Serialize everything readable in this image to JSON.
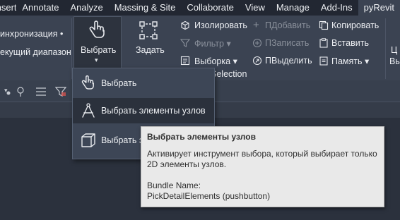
{
  "tabs": [
    "Insert",
    "Annotate",
    "Analyze",
    "Massing & Site",
    "Collaborate",
    "View",
    "Manage",
    "Add-Ins",
    "pyRevit"
  ],
  "active_tab": "pyRevit",
  "ribbon": {
    "left_item_1": "инхронизация",
    "left_item_1_suffix": "•",
    "left_item_2": "екущий диапазон",
    "select_button": "Выбрать",
    "select_arrow": "▾",
    "set_button": "Задать",
    "isolate": "Изолировать",
    "filter": "Фильтр",
    "selection": "Выборка",
    "p_add": "ПДобавить",
    "p_record": "ПЗаписать",
    "p_highlight": "ПВыделить",
    "copy": "Копировать",
    "paste": "Вставить",
    "memory": "Память",
    "panel_title": "Selection",
    "cut_right_1": "Ц",
    "cut_right_2": "Вы"
  },
  "dropdown": {
    "items": [
      {
        "label": "Выбрать",
        "icon": "hand-pointer-icon"
      },
      {
        "label": "Выбрать элементы узлов",
        "icon": "compass-icon"
      },
      {
        "label": "Выбрать э",
        "icon": "cube-icon"
      }
    ],
    "hover_index": 1
  },
  "tooltip": {
    "title": "Выбрать элементы узлов",
    "desc_line1": "Активирует инструмент выбора, который выбирает только",
    "desc_line2": "2D элементы узлов.",
    "bundle_label": "Bundle Name:",
    "bundle_value": "PickDetailElements (pushbutton)"
  },
  "colors": {
    "ribbon_bg": "#3b4352",
    "tabbar_bg": "#222732",
    "tooltip_bg": "#e9e9e9",
    "accent_red": "#d9534f"
  }
}
